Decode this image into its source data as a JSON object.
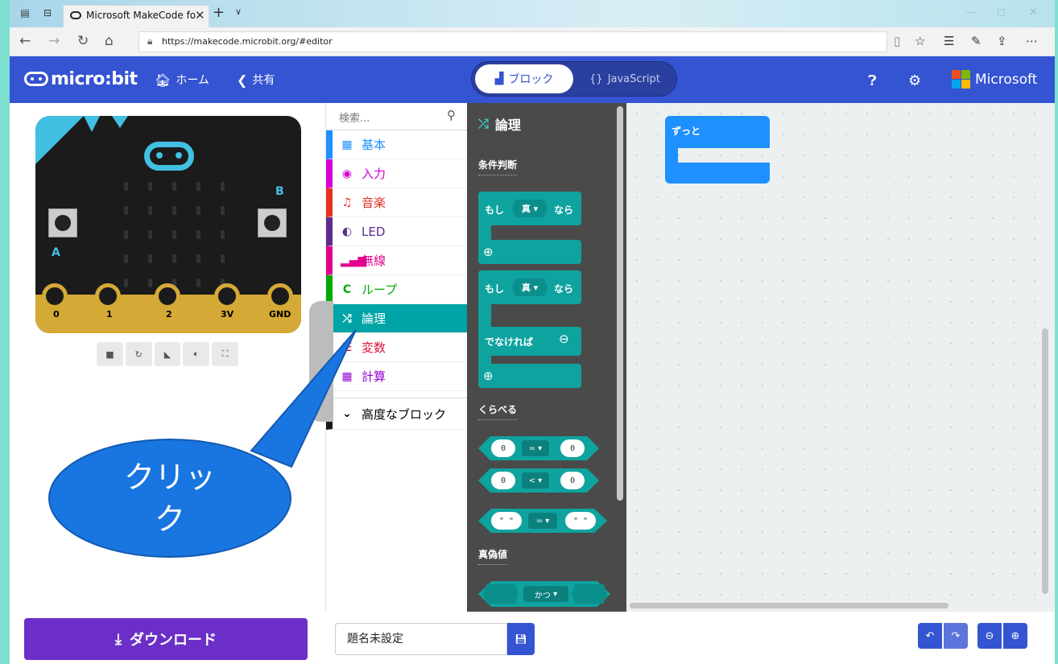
{
  "browser": {
    "tab_title": "Microsoft MakeCode fo",
    "url": "https://makecode.microbit.org/#editor"
  },
  "header": {
    "logo": "micro:bit",
    "home": "ホーム",
    "share": "共有",
    "blocks_tab": "ブロック",
    "js_tab": "JavaScript",
    "microsoft": "Microsoft"
  },
  "simulator": {
    "button_a": "A",
    "button_b": "B",
    "pins": [
      "0",
      "1",
      "2",
      "3V",
      "GND"
    ]
  },
  "categories": {
    "search_placeholder": "検索...",
    "items": [
      {
        "label": "基本",
        "color": "#1e90ff"
      },
      {
        "label": "入力",
        "color": "#d400d4"
      },
      {
        "label": "音楽",
        "color": "#e63022"
      },
      {
        "label": "LED",
        "color": "#5c2d91"
      },
      {
        "label": "無線",
        "color": "#e3008c"
      },
      {
        "label": "ループ",
        "color": "#00aa00"
      },
      {
        "label": "論理",
        "color": "#00a4a6"
      },
      {
        "label": "変数",
        "color": "#dc143c"
      },
      {
        "label": "計算",
        "color": "#9400d3"
      }
    ],
    "advanced": "高度なブロック"
  },
  "flyout": {
    "title": "論理",
    "section_conditions": "条件判断",
    "if_label": "もし",
    "true_label": "真",
    "then_label": "なら",
    "else_label": "でなければ",
    "section_compare": "くらべる",
    "zero": "0",
    "eq": "=",
    "lt": "<",
    "empty_str": "\" \"",
    "section_boolean": "真偽値",
    "and_label": "かつ"
  },
  "workspace": {
    "forever": "ずっと"
  },
  "bottom": {
    "download": "ダウンロード",
    "project_name": "題名未設定"
  },
  "callout": {
    "line1": "クリッ",
    "line2": "ク"
  }
}
